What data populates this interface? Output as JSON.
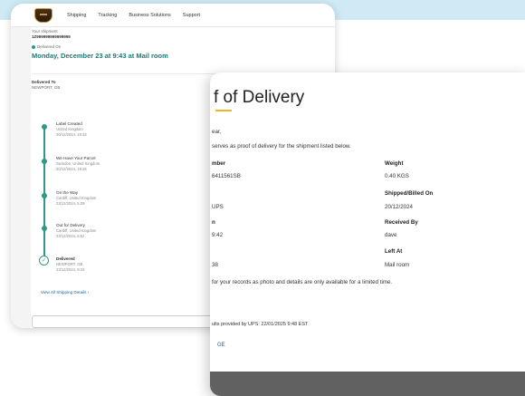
{
  "nav": {
    "links": [
      "Shipping",
      "Tracking",
      "Business Solutions",
      "Support"
    ]
  },
  "summary": {
    "label": "Your shipment",
    "tracking_number": "1Z999999999999999",
    "status": "Delivered On",
    "headline": "Monday, December 23 at 9:43 at Mail room"
  },
  "delivered_to": {
    "label": "Delivered To",
    "value": "NEWPORT, GB"
  },
  "timeline": [
    {
      "title": "Label Created",
      "place": "United Kingdom",
      "date": "20/12/2024, 19:32"
    },
    {
      "title": "We Have Your Parcel",
      "place": "Swindon, United Kingdom",
      "date": "20/12/2024, 19:25"
    },
    {
      "title": "On the Way",
      "place": "Cardiff, United Kingdom",
      "date": "23/12/2024, 5:09"
    },
    {
      "title": "Out for Delivery",
      "place": "Cardiff, United Kingdom",
      "date": "23/12/2024, 5:52"
    },
    {
      "title": "Delivered",
      "place": "NEWPORT, GB",
      "date": "23/12/2024, 9:43"
    }
  ],
  "view_all": "View All Shipping Details",
  "pod": {
    "title": "f of Delivery",
    "salutation": "ear,",
    "intro": "serves as proof of delivery for the shipment listed below.",
    "tracking_label": "mber",
    "tracking_value": "6411561SB",
    "weight_label": "Weight",
    "weight_value": "0.40 KGS",
    "service_value": "UPS",
    "shipped_label": "Shipped/Billed On",
    "shipped_value": "20/12/2024",
    "delivered_label": "n",
    "delivered_value": "9:42",
    "received_label": "Received By",
    "received_value": "dave",
    "location_label": "",
    "location_value": "38",
    "left_at_label": "Left At",
    "left_at_value": "Mail room",
    "note": "for your records as photo and details are only available for a limited time.",
    "results": "ults provided by UPS: 22/01/2025 9:48 EST",
    "bottom_link": "GE"
  }
}
